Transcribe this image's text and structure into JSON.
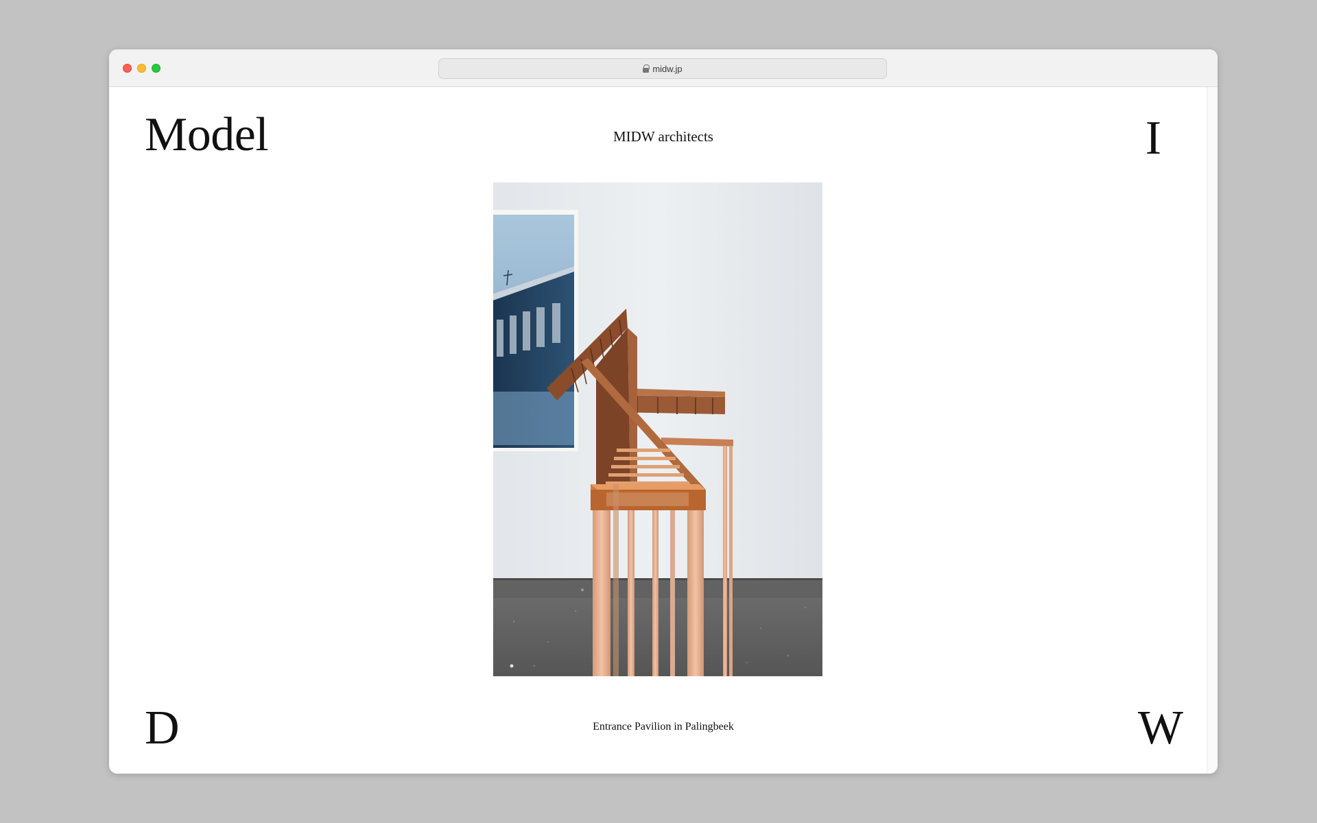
{
  "browser": {
    "url": "midw.jp"
  },
  "page": {
    "logo_left": "Model",
    "site_title": "MIDW architects",
    "corner_top_right": "I",
    "corner_bottom_left": "D",
    "corner_bottom_right": "W",
    "caption": "Entrance Pavilion in Palingbeek"
  },
  "colors": {
    "page_background": "#ffffff",
    "desktop_background": "#c2c2c2",
    "text": "#111111",
    "wood": "#b86a3e"
  },
  "icons": {
    "lock": "lock-icon",
    "share": "share-icon",
    "new_tab": "plus-icon",
    "tab_overview": "tabs-icon"
  }
}
